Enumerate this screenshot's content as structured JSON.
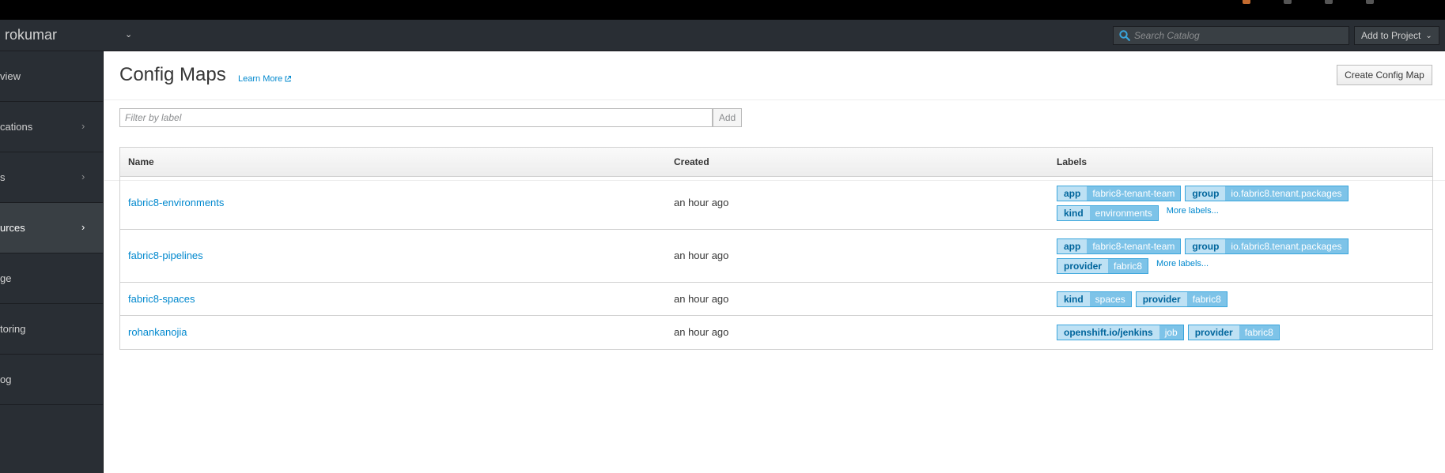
{
  "navbar": {
    "project_name": "rokumar",
    "search_placeholder": "Search Catalog",
    "add_to_project": "Add to Project"
  },
  "sidebar": {
    "items": [
      {
        "label": "view",
        "chevron": false,
        "active": false
      },
      {
        "label": "cations",
        "chevron": true,
        "active": false
      },
      {
        "label": "s",
        "chevron": true,
        "active": false
      },
      {
        "label": "urces",
        "chevron": true,
        "active": true
      },
      {
        "label": "ge",
        "chevron": false,
        "active": false
      },
      {
        "label": "toring",
        "chevron": false,
        "active": false
      },
      {
        "label": "og",
        "chevron": false,
        "active": false
      }
    ]
  },
  "page": {
    "title": "Config Maps",
    "learn_more": "Learn More",
    "create_button": "Create Config Map"
  },
  "filter": {
    "placeholder": "Filter by label",
    "add_button": "Add"
  },
  "table": {
    "headers": {
      "name": "Name",
      "created": "Created",
      "labels": "Labels"
    },
    "rows": [
      {
        "name": "fabric8-environments",
        "created": "an hour ago",
        "labels": [
          {
            "key": "app",
            "value": "fabric8-tenant-team"
          },
          {
            "key": "group",
            "value": "io.fabric8.tenant.packages"
          },
          {
            "key": "kind",
            "value": "environments"
          }
        ],
        "more_labels": "More labels..."
      },
      {
        "name": "fabric8-pipelines",
        "created": "an hour ago",
        "labels": [
          {
            "key": "app",
            "value": "fabric8-tenant-team"
          },
          {
            "key": "group",
            "value": "io.fabric8.tenant.packages"
          },
          {
            "key": "provider",
            "value": "fabric8"
          }
        ],
        "more_labels": "More labels..."
      },
      {
        "name": "fabric8-spaces",
        "created": "an hour ago",
        "labels": [
          {
            "key": "kind",
            "value": "spaces"
          },
          {
            "key": "provider",
            "value": "fabric8"
          }
        ],
        "more_labels": ""
      },
      {
        "name": "rohankanojia",
        "created": "an hour ago",
        "labels": [
          {
            "key": "openshift.io/jenkins",
            "value": "job"
          },
          {
            "key": "provider",
            "value": "fabric8"
          }
        ],
        "more_labels": ""
      }
    ]
  },
  "colors": {
    "navbar_bg": "#292e34",
    "link": "#0088ce",
    "label_key_bg": "#bee1f4",
    "label_value_bg": "#7dc3e8"
  }
}
